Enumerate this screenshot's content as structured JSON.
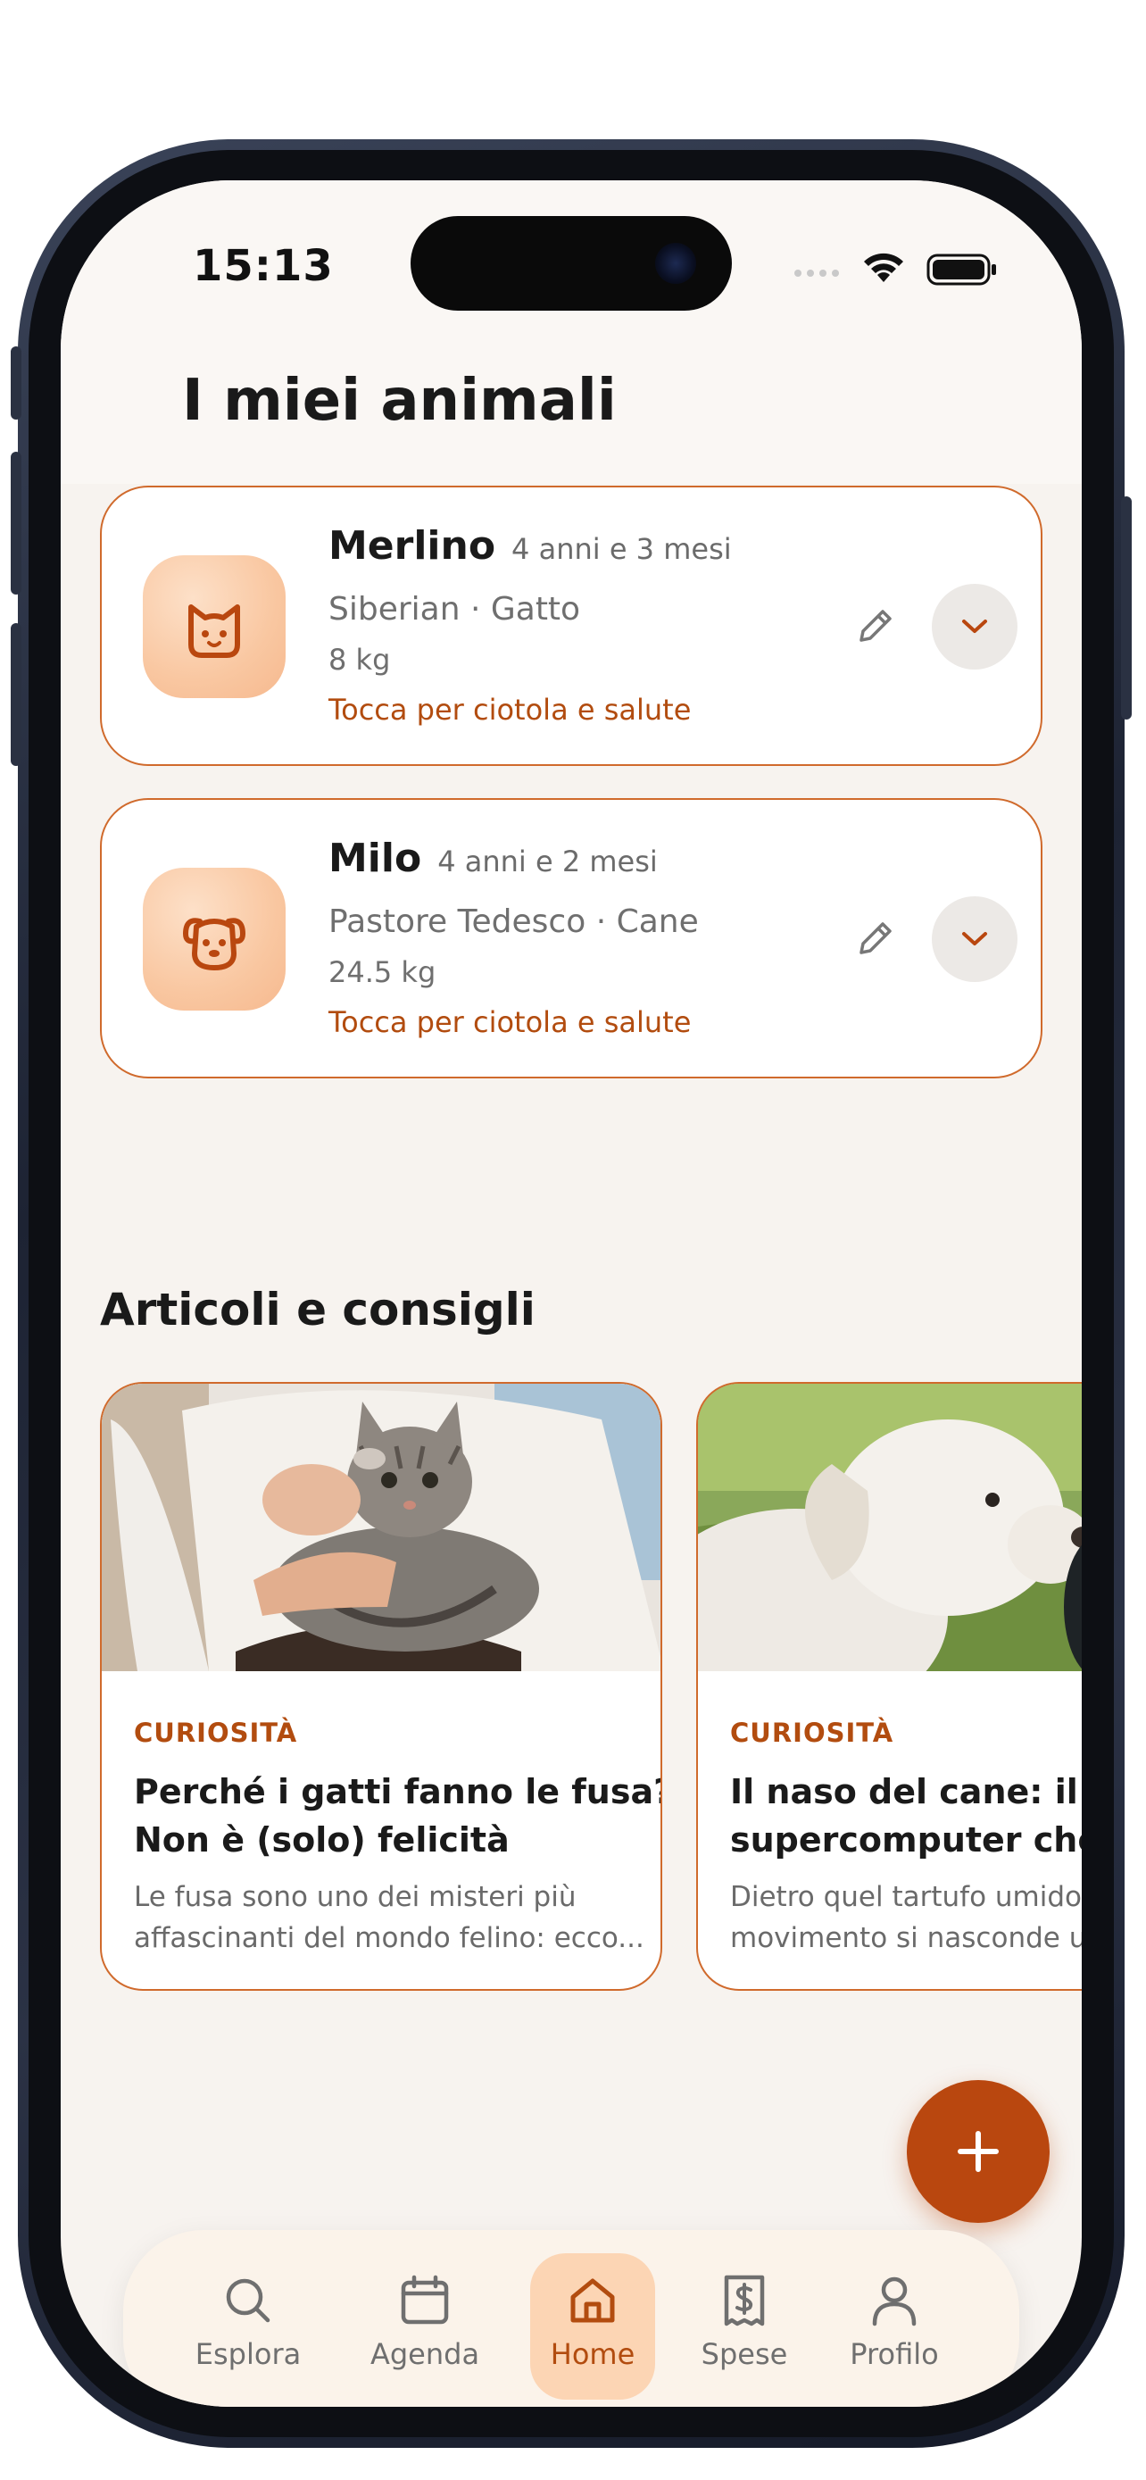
{
  "status_bar": {
    "time": "15:13"
  },
  "header": {
    "title": "I miei animali"
  },
  "pets": [
    {
      "name": "Merlino",
      "age": "4 anni e 3 mesi",
      "breed": "Siberian · Gatto",
      "weight": "8 kg",
      "cta": "Tocca per ciotola e salute",
      "icon": "cat-icon"
    },
    {
      "name": "Milo",
      "age": "4 anni e 2 mesi",
      "breed": "Pastore Tedesco · Cane",
      "weight": "24.5 kg",
      "cta": "Tocca per ciotola e salute",
      "icon": "dog-icon"
    }
  ],
  "articles_section": {
    "title": "Articoli e consigli",
    "items": [
      {
        "tag": "CURIOSITÀ",
        "title_line1": "Perché i gatti fanno le fusa?",
        "title_line2": "Non è (solo) felicità",
        "excerpt_line1": "Le fusa sono uno dei misteri più",
        "excerpt_line2": "affascinanti del mondo felino: ecco..."
      },
      {
        "tag": "CURIOSITÀ",
        "title_line1": "Il naso del cane: il",
        "title_line2": "supercomputer che fiu",
        "excerpt_line1": "Dietro quel tartufo umido s",
        "excerpt_line2": "movimento si nasconde un"
      }
    ]
  },
  "fab": {
    "icon": "plus-icon"
  },
  "bottom_nav": {
    "active": "Home",
    "items": [
      {
        "label": "Esplora",
        "icon": "search-icon"
      },
      {
        "label": "Agenda",
        "icon": "calendar-icon"
      },
      {
        "label": "Home",
        "icon": "home-icon"
      },
      {
        "label": "Spese",
        "icon": "receipt-icon"
      },
      {
        "label": "Profilo",
        "icon": "user-icon"
      }
    ]
  },
  "colors": {
    "accent": "#b9470f",
    "accent_text": "#b24c0f",
    "card_border": "#d06a2c",
    "avatar_bg": "#f9c7a1",
    "background": "#f7f3ef",
    "nav_active_bg": "#fcd5b4"
  }
}
